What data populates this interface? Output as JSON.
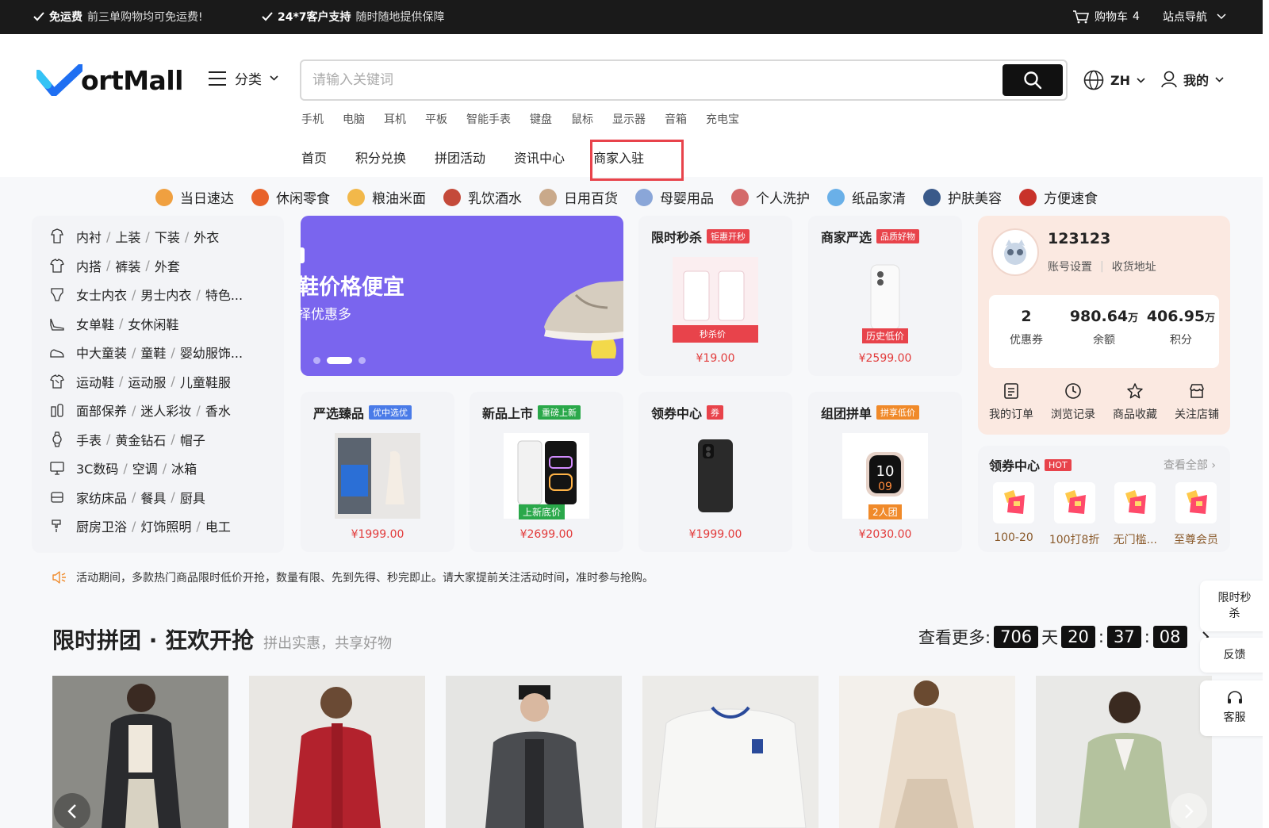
{
  "topbar": {
    "free_ship_title": "免运费",
    "free_ship_desc": "前三单购物均可免运费!",
    "support_title": "24*7客户支持",
    "support_desc": "随时随地提供保障",
    "cart_label": "购物车",
    "cart_count": "4",
    "site_nav": "站点导航"
  },
  "header": {
    "logo_text": "ortMall",
    "category_label": "分类",
    "search_placeholder": "请输入关键词",
    "lang": "ZH",
    "mine": "我的",
    "hot_keywords": [
      "手机",
      "电脑",
      "耳机",
      "平板",
      "智能手表",
      "键盘",
      "鼠标",
      "显示器",
      "音箱",
      "充电宝"
    ],
    "nav": [
      "首页",
      "积分兑换",
      "拼团活动",
      "资讯中心",
      "商家入驻"
    ]
  },
  "category_row": [
    {
      "label": "当日速达",
      "color": "#f0a040"
    },
    {
      "label": "休闲零食",
      "color": "#e8622a"
    },
    {
      "label": "粮油米面",
      "color": "#f2b84a"
    },
    {
      "label": "乳饮酒水",
      "color": "#c44a3a"
    },
    {
      "label": "日用百货",
      "color": "#c9a98a"
    },
    {
      "label": "母婴用品",
      "color": "#8aa6d8"
    },
    {
      "label": "个人洗护",
      "color": "#d46a6a"
    },
    {
      "label": "纸品家清",
      "color": "#6ab0e8"
    },
    {
      "label": "护肤美容",
      "color": "#3a5a8a"
    },
    {
      "label": "方便速食",
      "color": "#c8322a"
    }
  ],
  "sidebar": [
    {
      "icon": "shirt-icon",
      "items": [
        "内衬",
        "上装",
        "下装",
        "外衣"
      ]
    },
    {
      "icon": "tshirt-icon",
      "items": [
        "内搭",
        "裤装",
        "外套"
      ]
    },
    {
      "icon": "underwear-icon",
      "items": [
        "女士内衣",
        "男士内衣",
        "特色..."
      ]
    },
    {
      "icon": "heel-icon",
      "items": [
        "女单鞋",
        "女休闲鞋"
      ]
    },
    {
      "icon": "child-shoe-icon",
      "items": [
        "中大童装",
        "童鞋",
        "婴幼服饰..."
      ]
    },
    {
      "icon": "sports-shirt-icon",
      "items": [
        "运动鞋",
        "运动服",
        "儿童鞋服"
      ]
    },
    {
      "icon": "cosmetics-icon",
      "items": [
        "面部保养",
        "迷人彩妆",
        "香水"
      ]
    },
    {
      "icon": "watch-icon",
      "items": [
        "手表",
        "黄金钻石",
        "帽子"
      ]
    },
    {
      "icon": "monitor-icon",
      "items": [
        "3C数码",
        "空调",
        "冰箱"
      ]
    },
    {
      "icon": "bed-icon",
      "items": [
        "家纺床品",
        "餐具",
        "厨具"
      ]
    },
    {
      "icon": "faucet-icon",
      "items": [
        "厨房卫浴",
        "灯饰照明",
        "电工"
      ]
    }
  ],
  "banner": {
    "title": "鞋价格便宜",
    "subtitle": "择优惠多"
  },
  "cards": [
    {
      "title": "限时秒杀",
      "tag": "钜惠开秒",
      "tag_color": "#e8434b",
      "price": "¥19.00",
      "badge": "秒杀价"
    },
    {
      "title": "商家严选",
      "tag": "品质好物",
      "tag_color": "#e8434b",
      "price": "¥2599.00",
      "badge": "历史低价"
    },
    {
      "title": "严选臻品",
      "tag": "优中选优",
      "tag_color": "#4a7be8",
      "price": "¥1999.00",
      "badge": ""
    },
    {
      "title": "新品上市",
      "tag": "重磅上新",
      "tag_color": "#2aa84a",
      "price": "¥2699.00",
      "badge": "上新底价"
    },
    {
      "title": "领券中心",
      "tag": "券",
      "tag_color": "#e8434b",
      "price": "¥1999.00",
      "badge": ""
    },
    {
      "title": "组团拼单",
      "tag": "拼享低价",
      "tag_color": "#f08a2a",
      "price": "¥2030.00",
      "badge": "2人团"
    }
  ],
  "user": {
    "name": "123123",
    "account_settings": "账号设置",
    "address": "收货地址",
    "stats": [
      {
        "value": "2",
        "unit": "",
        "label": "优惠券"
      },
      {
        "value": "980.64",
        "unit": "万",
        "label": "余额"
      },
      {
        "value": "406.95",
        "unit": "万",
        "label": "积分"
      }
    ],
    "actions": [
      {
        "icon": "order-icon",
        "label": "我的订单"
      },
      {
        "icon": "clock-icon",
        "label": "浏览记录"
      },
      {
        "icon": "star-icon",
        "label": "商品收藏"
      },
      {
        "icon": "store-icon",
        "label": "关注店铺"
      }
    ]
  },
  "coupon_center": {
    "title": "领券中心",
    "hot": "HOT",
    "more": "查看全部",
    "items": [
      "100-20",
      "100打8折",
      "无门槛...",
      "至尊会员"
    ]
  },
  "notice": "活动期间，多款热门商品限时低价开抢，数量有限、先到先得、秒完即止。请大家提前关注活动时间，准时参与抢购。",
  "group_section": {
    "title": "限时拼团 · 狂欢开抢",
    "subtitle": "拼出实惠，共享好物",
    "more_label": "查看更多:",
    "days": "706",
    "day_unit": "天",
    "hours": "20",
    "minutes": "37",
    "seconds": "08"
  },
  "float_bar": {
    "flash": "限时秒杀",
    "feedback": "反馈",
    "service": "客服"
  },
  "colors": {
    "accent": "#e8434b",
    "logo_blue": "#1f6ff2",
    "banner": "#7a65ee"
  }
}
